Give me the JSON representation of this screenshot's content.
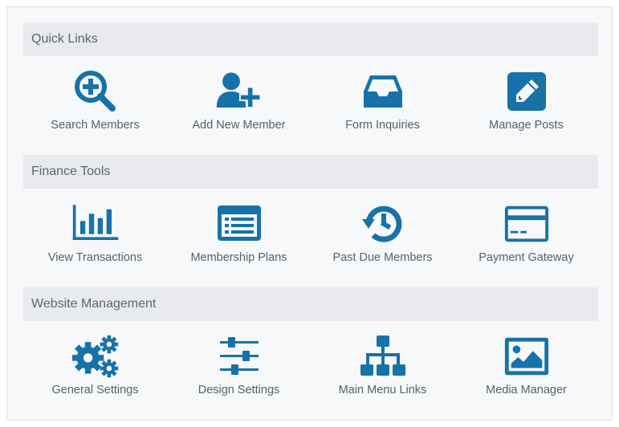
{
  "theme": {
    "accent": "#1772a8",
    "header_bg": "#e8eaed",
    "panel_bg": "#f7f8fa",
    "text": "#55606b"
  },
  "sections": [
    {
      "title": "Quick Links",
      "items": [
        {
          "label": "Search Members",
          "icon": "search-plus-icon"
        },
        {
          "label": "Add New Member",
          "icon": "user-plus-icon"
        },
        {
          "label": "Form Inquiries",
          "icon": "inbox-icon"
        },
        {
          "label": "Manage Posts",
          "icon": "pencil-square-icon"
        }
      ]
    },
    {
      "title": "Finance Tools",
      "items": [
        {
          "label": "View Transactions",
          "icon": "bar-chart-icon"
        },
        {
          "label": "Membership Plans",
          "icon": "list-alt-icon"
        },
        {
          "label": "Past Due Members",
          "icon": "history-icon"
        },
        {
          "label": "Payment Gateway",
          "icon": "credit-card-icon"
        }
      ]
    },
    {
      "title": "Website Management",
      "items": [
        {
          "label": "General Settings",
          "icon": "gears-icon"
        },
        {
          "label": "Design Settings",
          "icon": "sliders-icon"
        },
        {
          "label": "Main Menu Links",
          "icon": "sitemap-icon"
        },
        {
          "label": "Media Manager",
          "icon": "image-icon"
        }
      ]
    }
  ]
}
